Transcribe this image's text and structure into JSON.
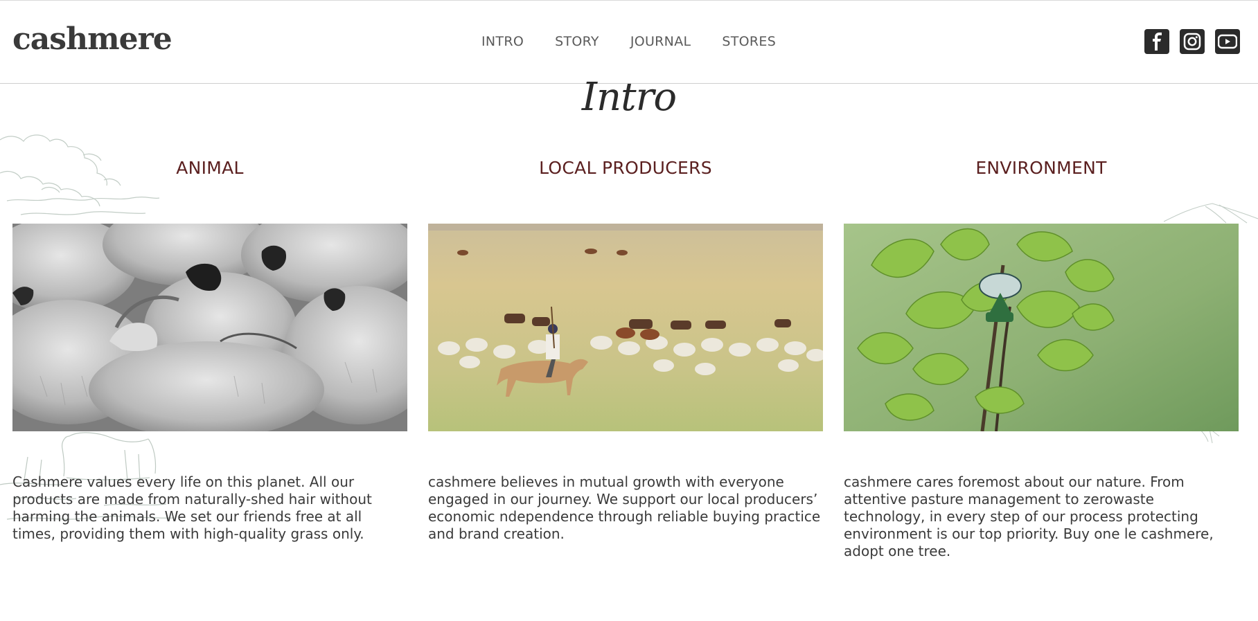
{
  "header": {
    "logo": "cashmere",
    "nav": [
      "INTRO",
      "STORY",
      "JOURNAL",
      "STORES"
    ],
    "socials": [
      "facebook-icon",
      "instagram-icon",
      "youtube-icon"
    ]
  },
  "section_title": "Intro",
  "columns": [
    {
      "heading": "ANIMAL",
      "image": "goats-herd-photo",
      "text": "Cashmere values every life on this planet. All our products are made from naturally-shed hair without harming the animals. We set our friends free at all times, providing them with high-quality grass only."
    },
    {
      "heading": "LOCAL PRODUCERS",
      "image": "herder-on-horse-photo",
      "text": "cashmere believes in mutual growth with everyone engaged in our journey. We support our local producers’ economic ndependence through reliable buying practice and brand creation."
    },
    {
      "heading": "ENVIRONMENT",
      "image": "young-tree-photo",
      "text": "cashmere cares foremost about our nature. From attentive pasture management to zerowaste technology, in every step of our process protecting environment is our top priority. Buy one le cashmere, adopt one tree."
    }
  ],
  "colors": {
    "heading": "#5b2020",
    "text": "#3a3a3a",
    "icon_bg": "#2b2b2b"
  }
}
